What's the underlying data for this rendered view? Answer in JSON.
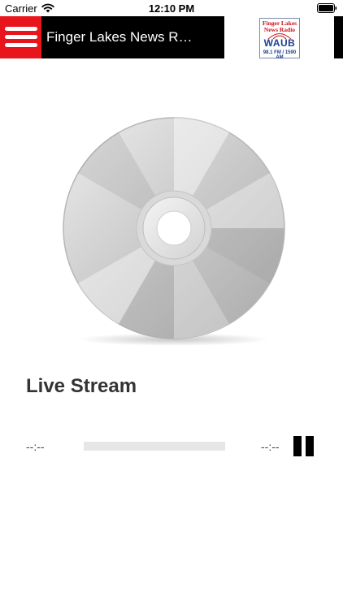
{
  "status_bar": {
    "carrier": "Carrier",
    "time": "12:10 PM",
    "wifi_icon": "wifi-icon",
    "battery_icon": "battery-icon"
  },
  "header": {
    "menu_icon": "hamburger-menu-icon",
    "title": "Finger Lakes News R…",
    "logo": {
      "line1": "Finger Lakes",
      "line2": "News Radio",
      "call_sign": "WAUB",
      "frequency": "98.1 FM / 1590 AM"
    }
  },
  "player": {
    "album_art_icon": "cd-disc-icon",
    "track_title": "Live Stream",
    "elapsed": "--:--",
    "remaining": "--:--",
    "progress_fraction": 0,
    "pause_icon": "pause-icon"
  },
  "colors": {
    "menu_red": "#e8161c",
    "title_bar": "#000000",
    "logo_red": "#c8141e",
    "logo_blue": "#1c3f8f",
    "track_progress": "#e6e6e6"
  }
}
